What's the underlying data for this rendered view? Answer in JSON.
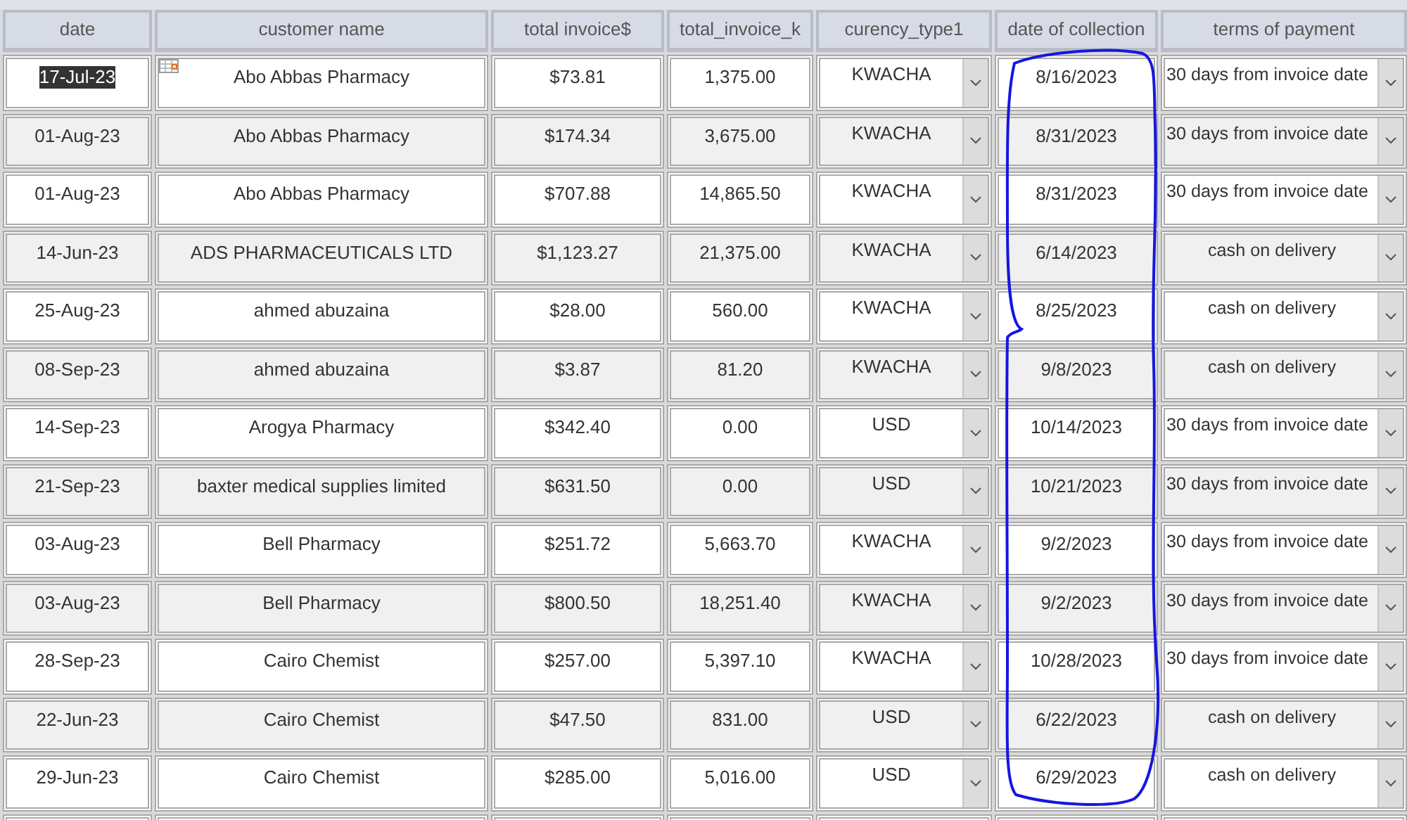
{
  "columns": [
    "date",
    "customer name",
    "total invoice$",
    "total_invoice_k",
    "curency_type1",
    "date of collection",
    "terms of payment"
  ],
  "rows": [
    {
      "date": "17-Jul-23",
      "selected": true,
      "customer": "Abo Abbas Pharmacy",
      "total_usd": "$73.81",
      "total_k": "1,375.00",
      "currency": "KWACHA",
      "collection": "8/16/2023",
      "terms": "30 days from invoice date"
    },
    {
      "date": "01-Aug-23",
      "selected": false,
      "customer": "Abo Abbas Pharmacy",
      "total_usd": "$174.34",
      "total_k": "3,675.00",
      "currency": "KWACHA",
      "collection": "8/31/2023",
      "terms": "30 days from invoice date"
    },
    {
      "date": "01-Aug-23",
      "selected": false,
      "customer": "Abo Abbas Pharmacy",
      "total_usd": "$707.88",
      "total_k": "14,865.50",
      "currency": "KWACHA",
      "collection": "8/31/2023",
      "terms": "30 days from invoice date"
    },
    {
      "date": "14-Jun-23",
      "selected": false,
      "customer": "ADS PHARMACEUTICALS LTD",
      "total_usd": "$1,123.27",
      "total_k": "21,375.00",
      "currency": "KWACHA",
      "collection": "6/14/2023",
      "terms": "cash on delivery"
    },
    {
      "date": "25-Aug-23",
      "selected": false,
      "customer": "ahmed abuzaina",
      "total_usd": "$28.00",
      "total_k": "560.00",
      "currency": "KWACHA",
      "collection": "8/25/2023",
      "terms": "cash on delivery"
    },
    {
      "date": "08-Sep-23",
      "selected": false,
      "customer": "ahmed abuzaina",
      "total_usd": "$3.87",
      "total_k": "81.20",
      "currency": "KWACHA",
      "collection": "9/8/2023",
      "terms": "cash on delivery"
    },
    {
      "date": "14-Sep-23",
      "selected": false,
      "customer": "Arogya Pharmacy",
      "total_usd": "$342.40",
      "total_k": "0.00",
      "currency": "USD",
      "collection": "10/14/2023",
      "terms": "30 days from invoice date"
    },
    {
      "date": "21-Sep-23",
      "selected": false,
      "customer": "baxter medical supplies limited",
      "total_usd": "$631.50",
      "total_k": "0.00",
      "currency": "USD",
      "collection": "10/21/2023",
      "terms": "30 days from invoice date"
    },
    {
      "date": "03-Aug-23",
      "selected": false,
      "customer": "Bell Pharmacy",
      "total_usd": "$251.72",
      "total_k": "5,663.70",
      "currency": "KWACHA",
      "collection": "9/2/2023",
      "terms": "30 days from invoice date"
    },
    {
      "date": "03-Aug-23",
      "selected": false,
      "customer": "Bell Pharmacy",
      "total_usd": "$800.50",
      "total_k": "18,251.40",
      "currency": "KWACHA",
      "collection": "9/2/2023",
      "terms": "30 days from invoice date"
    },
    {
      "date": "28-Sep-23",
      "selected": false,
      "customer": "Cairo Chemist",
      "total_usd": "$257.00",
      "total_k": "5,397.10",
      "currency": "KWACHA",
      "collection": "10/28/2023",
      "terms": "30 days from invoice date"
    },
    {
      "date": "22-Jun-23",
      "selected": false,
      "customer": "Cairo Chemist",
      "total_usd": "$47.50",
      "total_k": "831.00",
      "currency": "USD",
      "collection": "6/22/2023",
      "terms": "cash on delivery"
    },
    {
      "date": "29-Jun-23",
      "selected": false,
      "customer": "Cairo Chemist",
      "total_usd": "$285.00",
      "total_k": "5,016.00",
      "currency": "USD",
      "collection": "6/29/2023",
      "terms": "cash on delivery"
    }
  ]
}
